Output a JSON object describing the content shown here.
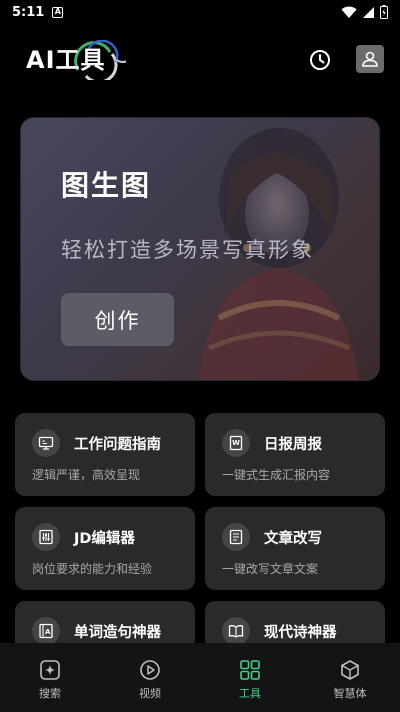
{
  "status_bar": {
    "time": "5:11",
    "notification_glyph": "A"
  },
  "header": {
    "title": "AI工具"
  },
  "hero": {
    "title": "图生图",
    "subtitle": "轻松打造多场景写真形象",
    "button_label": "创作"
  },
  "tools": [
    {
      "title": "工作问题指南",
      "desc": "逻辑严谨，高效呈现",
      "icon": "monitor-icon"
    },
    {
      "title": "日报周报",
      "desc": "一键式生成汇报内容",
      "icon": "word-doc-icon"
    },
    {
      "title": "JD编辑器",
      "desc": "岗位要求的能力和经验",
      "icon": "sliders-icon"
    },
    {
      "title": "文章改写",
      "desc": "一键改写文章文案",
      "icon": "document-icon"
    },
    {
      "title": "单词造句神器",
      "desc": "",
      "icon": "letter-a-icon"
    },
    {
      "title": "现代诗神器",
      "desc": "",
      "icon": "open-book-icon"
    }
  ],
  "nav": [
    {
      "label": "搜索",
      "icon": "sparkle-search-icon",
      "active": false
    },
    {
      "label": "视频",
      "icon": "play-circle-icon",
      "active": false
    },
    {
      "label": "工具",
      "icon": "grid-icon",
      "active": true
    },
    {
      "label": "智慧体",
      "icon": "cube-icon",
      "active": false
    }
  ],
  "colors": {
    "accent": "#3fd38a",
    "card_bg": "#2a2a2c",
    "background": "#000000"
  }
}
